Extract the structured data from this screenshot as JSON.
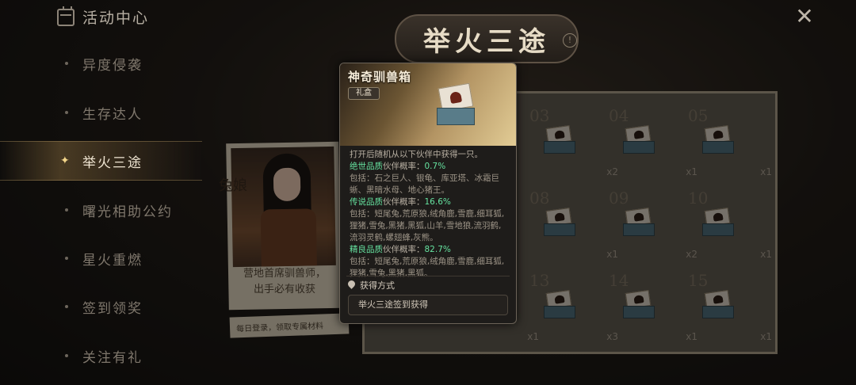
{
  "sidebar": {
    "title": "活动中心",
    "items": [
      {
        "label": "异度侵袭",
        "active": false
      },
      {
        "label": "生存达人",
        "active": false
      },
      {
        "label": "举火三途",
        "active": true
      },
      {
        "label": "曙光相助公约",
        "active": false
      },
      {
        "label": "星火重燃",
        "active": false
      },
      {
        "label": "签到领奖",
        "active": false
      },
      {
        "label": "关注有礼",
        "active": false
      }
    ]
  },
  "banner": {
    "title": "举火三途"
  },
  "character": {
    "name": "兔娘",
    "desc_line1": "营地首席驯兽师，",
    "desc_line2": "出手必有收获",
    "note": "每日登录，领取专属材料"
  },
  "calendar": {
    "days": [
      {
        "num": "03",
        "count": ""
      },
      {
        "num": "04",
        "count": "x2"
      },
      {
        "num": "05",
        "count": "x1"
      },
      {
        "num": "08",
        "count": ""
      },
      {
        "num": "09",
        "count": "x1"
      },
      {
        "num": "10",
        "count": "x2"
      },
      {
        "num": "13",
        "count": "x1"
      },
      {
        "num": "14",
        "count": "x3"
      },
      {
        "num": "15",
        "count": "x1"
      }
    ],
    "extra_counts": [
      "x1",
      "x1",
      "x1"
    ]
  },
  "tooltip": {
    "title": "神奇驯兽箱",
    "tag": "礼盒",
    "intro": "打开后随机从以下伙伴中获得一只。",
    "tiers": [
      {
        "quality": "绝世品质",
        "rate_label": "伙伴概率：",
        "pct": "0.7%",
        "includes": "包括：石之巨人、银龟、库亚塔、冰霜巨蜥、黑暗水母、地心猪王。"
      },
      {
        "quality": "传说品质",
        "rate_label": "伙伴概率：",
        "pct": "16.6%",
        "includes": "包括：短尾兔,荒原狼,绒角鹿,雪鹿,细耳狐,狸猪,雪兔,黑猪,黑狐,山羊,雪地狼,流羽鹤,流羽灵鹤,螺翅蜂,灰熊。"
      },
      {
        "quality": "精良品质",
        "rate_label": "伙伴概率：",
        "pct": "82.7%",
        "includes": "包括：短尾兔,荒原狼,绒角鹿,雪鹿,细耳狐,狸猪,雪兔,黑猪,黑狐。"
      }
    ],
    "source_heading": "获得方式",
    "source_item": "举火三途签到获得"
  },
  "close_label": "✕",
  "info_label": "!"
}
